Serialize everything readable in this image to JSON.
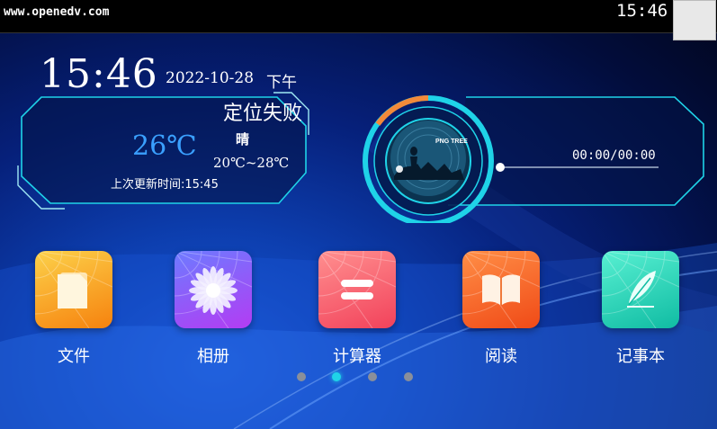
{
  "status_bar": {
    "site": "www.openedv.com",
    "time": "15:46"
  },
  "clock": {
    "time": "15:46",
    "date": "2022-10-28",
    "ampm": "下午"
  },
  "weather": {
    "location": "定位失败",
    "temperature": "26℃",
    "condition": "晴",
    "range": "20℃~28℃",
    "updated": "上次更新时间:15:45"
  },
  "player": {
    "album_text": "PNG TREE",
    "time": "00:00/00:00",
    "progress": 0
  },
  "apps": [
    {
      "label": "文件",
      "icon": "file-icon",
      "color_top": "#fcd14a",
      "color_bottom": "#f6820e"
    },
    {
      "label": "相册",
      "icon": "flower-icon",
      "color_top": "#6d7bff",
      "color_bottom": "#b33cf3"
    },
    {
      "label": "计算器",
      "icon": "equals-icon",
      "color_top": "#ff8f8f",
      "color_bottom": "#f2425b"
    },
    {
      "label": "阅读",
      "icon": "book-icon",
      "color_top": "#ff8e46",
      "color_bottom": "#f04a17"
    },
    {
      "label": "记事本",
      "icon": "feather-icon",
      "color_top": "#58f0d2",
      "color_bottom": "#10bca3"
    }
  ],
  "pager": {
    "pages": 4,
    "active": 1
  },
  "colors": {
    "accent": "#1fd3e8",
    "temperature": "#3aa0ff"
  }
}
